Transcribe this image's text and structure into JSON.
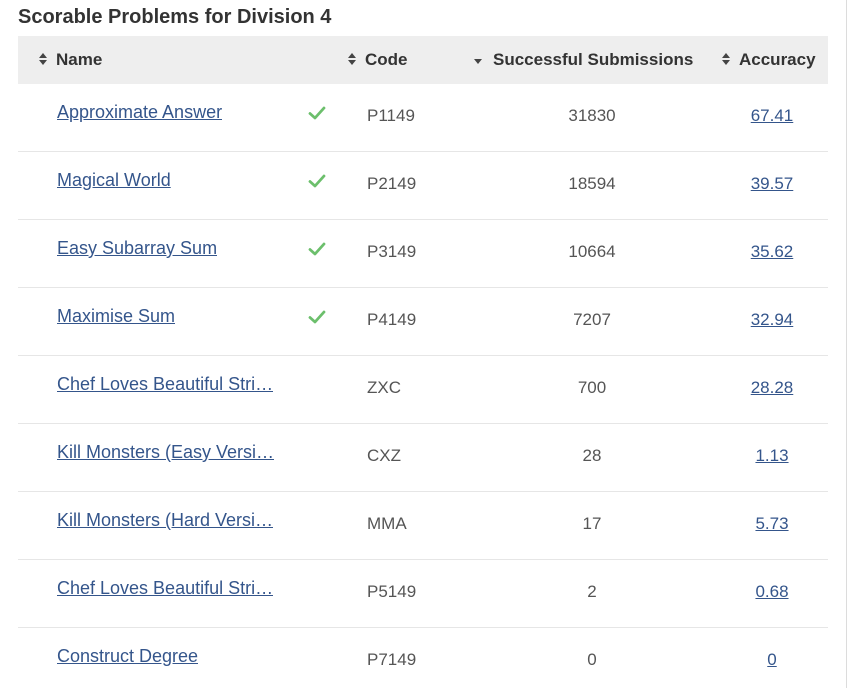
{
  "title": "Scorable Problems for Division 4",
  "columns": {
    "name": "Name",
    "code": "Code",
    "submissions": "Successful Submissions",
    "accuracy": "Accuracy"
  },
  "icons": {
    "sort": "sort-both-icon",
    "sort_desc": "sort-desc-icon",
    "solved": "checkmark-icon"
  },
  "colors": {
    "link": "#34558b",
    "check": "#6cbf6c",
    "header_bg": "#eeeeee"
  },
  "rows": [
    {
      "name": "Approximate Answer",
      "solved": true,
      "code": "P1149",
      "submissions": "31830",
      "accuracy": "67.41"
    },
    {
      "name": "Magical World",
      "solved": true,
      "code": "P2149",
      "submissions": "18594",
      "accuracy": "39.57"
    },
    {
      "name": "Easy Subarray Sum",
      "solved": true,
      "code": "P3149",
      "submissions": "10664",
      "accuracy": "35.62"
    },
    {
      "name": "Maximise Sum",
      "solved": true,
      "code": "P4149",
      "submissions": "7207",
      "accuracy": "32.94"
    },
    {
      "name": "Chef Loves Beautiful Stri…",
      "solved": false,
      "code": "ZXC",
      "submissions": "700",
      "accuracy": "28.28"
    },
    {
      "name": "Kill Monsters (Easy Versi…",
      "solved": false,
      "code": "CXZ",
      "submissions": "28",
      "accuracy": "1.13"
    },
    {
      "name": "Kill Monsters (Hard Versi…",
      "solved": false,
      "code": "MMA",
      "submissions": "17",
      "accuracy": "5.73"
    },
    {
      "name": "Chef Loves Beautiful Stri…",
      "solved": false,
      "code": "P5149",
      "submissions": "2",
      "accuracy": "0.68"
    },
    {
      "name": "Construct Degree",
      "solved": false,
      "code": "P7149",
      "submissions": "0",
      "accuracy": "0"
    }
  ]
}
